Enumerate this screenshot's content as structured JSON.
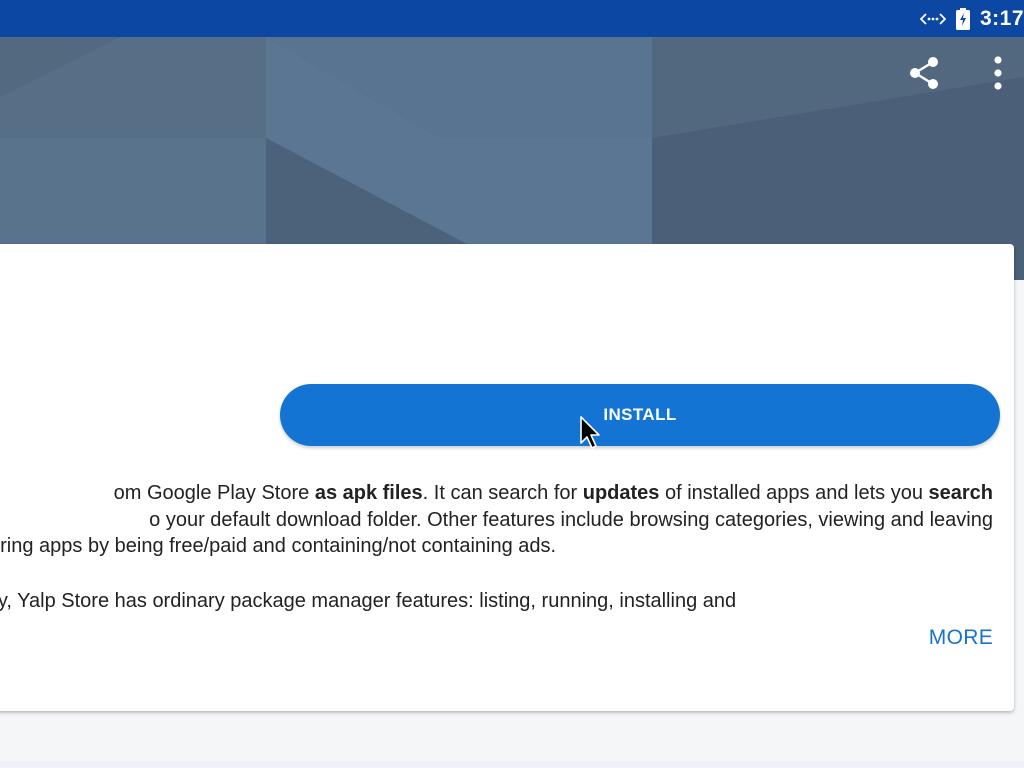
{
  "status_bar": {
    "time": "3:17",
    "icons": [
      "sync-icon",
      "battery-charging-icon"
    ],
    "background": "#0b47a3"
  },
  "header": {
    "background": "#4a6078",
    "actions": [
      "share-icon",
      "more-vert-icon"
    ]
  },
  "install_button": {
    "label": "INSTALL",
    "color": "#1474d4"
  },
  "description": {
    "line1_a": "om Google Play Store ",
    "line1_b": "as apk files",
    "line1_c": ". It can search for ",
    "line1_d": "updates",
    "line1_e": " of installed apps and lets you ",
    "line1_f": "search",
    "line2": "o your default download folder. Other features include browsing categories, viewing and leaving",
    "line3": "filtering apps by being free/paid and containing/not containing ads.",
    "line4": " Play, Yalp Store has ordinary package manager features: listing, running, installing and"
  },
  "more_link": {
    "label": "MORE",
    "color": "#1a73c9"
  }
}
